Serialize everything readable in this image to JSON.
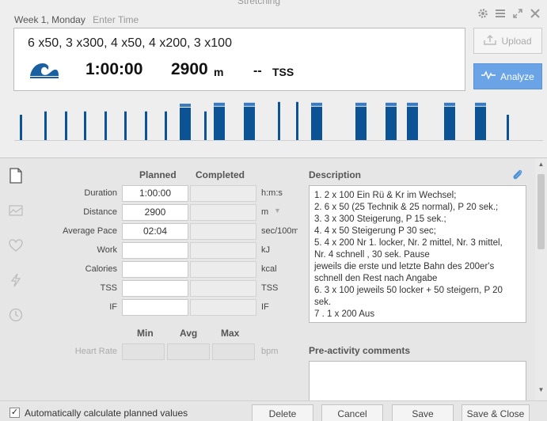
{
  "window": {
    "bg_title": "Stretching"
  },
  "header": {
    "date_label": "Week 1, Monday",
    "time_placeholder": "Enter Time",
    "workout_title": "6 x50, 3 x300, 4 x50, 4 x200, 3 x100",
    "sport_icon": "swim-wave-icon",
    "duration": "1:00:00",
    "distance": "2900",
    "distance_unit": "m",
    "tss_value": "--",
    "tss_unit": "TSS",
    "upload_label": "Upload",
    "analyze_label": "Analyze",
    "accent_color": "#0b5394"
  },
  "sidebar": {
    "icons": [
      "document-icon",
      "chart-line-icon",
      "heart-icon",
      "lightning-icon",
      "clock-icon"
    ]
  },
  "form": {
    "planned_header": "Planned",
    "completed_header": "Completed",
    "rows": [
      {
        "label": "Duration",
        "planned": "1:00:00",
        "unit": "h:m:s"
      },
      {
        "label": "Distance",
        "planned": "2900",
        "unit": "m"
      },
      {
        "label": "Average Pace",
        "planned": "02:04",
        "unit": "sec/100m"
      },
      {
        "label": "Work",
        "planned": "",
        "unit": "kJ"
      },
      {
        "label": "Calories",
        "planned": "",
        "unit": "kcal"
      },
      {
        "label": "TSS",
        "planned": "",
        "unit": "TSS"
      },
      {
        "label": "IF",
        "planned": "",
        "unit": "IF"
      }
    ],
    "hr_min_header": "Min",
    "hr_avg_header": "Avg",
    "hr_max_header": "Max",
    "hr_label": "Heart Rate",
    "hr_unit": "bpm"
  },
  "description": {
    "title": "Description",
    "text": "1. 2 x 100 Ein Rü & Kr im Wechsel;\n2. 6 x 50 (25 Technik & 25 normal), P 20 sek.;\n3. 3 x 300 Steigerung, P 15 sek.;\n4. 4 x 50 Steigerung P 30 sec;\n5. 4 x 200 Nr 1. locker, Nr. 2 mittel, Nr. 3 mittel,\nNr. 4 schnell , 30 sek. Pause\njeweils die erste und letzte Bahn des 200er's\nschnell den Rest nach Angabe\n6. 3 x 100 jeweils 50 locker + 50 steigern, P 20\nsek.\n7 . 1 x 200 Aus",
    "pre_title": "Pre-activity comments"
  },
  "footer": {
    "auto_label": "Automatically calculate planned values",
    "delete": "Delete",
    "cancel": "Cancel",
    "save": "Save",
    "save_close": "Save & Close"
  },
  "intervals": {
    "bars": [
      {
        "h": 0.55
      },
      {
        "h": 0.62
      },
      {
        "h": 0.62
      },
      {
        "h": 0.62
      },
      {
        "h": 0.62
      },
      {
        "h": 0.62
      },
      {
        "h": 0.62
      },
      {
        "h": 0.62
      },
      {
        "h": 0.62
      },
      {
        "h": 0.7,
        "w": 1
      },
      {
        "h": 0.72,
        "w": 1
      },
      {
        "h": 0.72,
        "w": 1
      },
      {
        "h": 0.82
      },
      {
        "h": 0.82
      },
      {
        "h": 0.72,
        "w": 1
      },
      {
        "h": 0.72,
        "w": 1
      },
      {
        "h": 0.72,
        "w": 1
      },
      {
        "h": 0.72,
        "w": 1
      },
      {
        "h": 0.72,
        "w": 1
      },
      {
        "h": 0.72,
        "w": 1
      },
      {
        "h": 0.55
      }
    ]
  }
}
